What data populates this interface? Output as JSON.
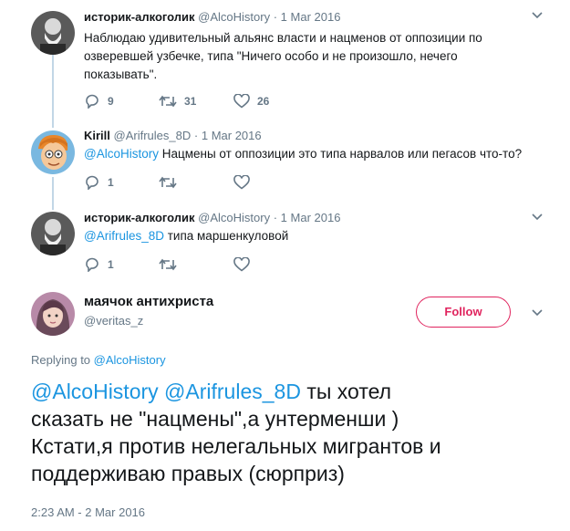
{
  "tweets": [
    {
      "name": "историк-алкоголик",
      "handle": "@AlcoHistory",
      "dot": "·",
      "date": "1 Mar 2016",
      "text_lines": [
        "Наблюдаю удивительный альянс власти и нацменов от оппозиции по",
        "озверевшей узбечке, типа \"Ничего особо и не произошло, нечего",
        "показывать\"."
      ],
      "replies": "9",
      "retweets": "31",
      "likes": "26"
    },
    {
      "name": "Kirill",
      "handle": "@Arifrules_8D",
      "dot": "·",
      "date": "1 Mar 2016",
      "mention": "@AlcoHistory",
      "text": " Нацмены от оппозиции это типа нарвалов или пегасов что-то?",
      "replies": "1"
    },
    {
      "name": "историк-алкоголик",
      "handle": "@AlcoHistory",
      "dot": "·",
      "date": "1 Mar 2016",
      "mention": "@Arifrules_8D",
      "text": " типа маршенкуловой",
      "replies": "1"
    }
  ],
  "main_tweet": {
    "name": "маячок антихриста",
    "handle": "@veritas_z",
    "follow_label": "Follow",
    "replying_prefix": "Replying to ",
    "replying_handle": "@AlcoHistory",
    "mention1": "@AlcoHistory",
    "mention2": "@Arifrules_8D",
    "line1_rest": " ты хотел",
    "line2": "сказать не \"нацмены\",а унтерменши )",
    "line3": "Кстати,я против нелегальных мигрантов и",
    "line4": "поддерживаю правых (сюрприз)",
    "timestamp": "2:23 AM - 2 Mar 2016"
  },
  "colors": {
    "link": "#1b95e0",
    "follow": "#e0245e",
    "muted": "#657786",
    "thread_line": "#c2d6e6"
  },
  "icons": [
    "reply-icon",
    "retweet-icon",
    "like-icon",
    "chevron-down-icon"
  ]
}
